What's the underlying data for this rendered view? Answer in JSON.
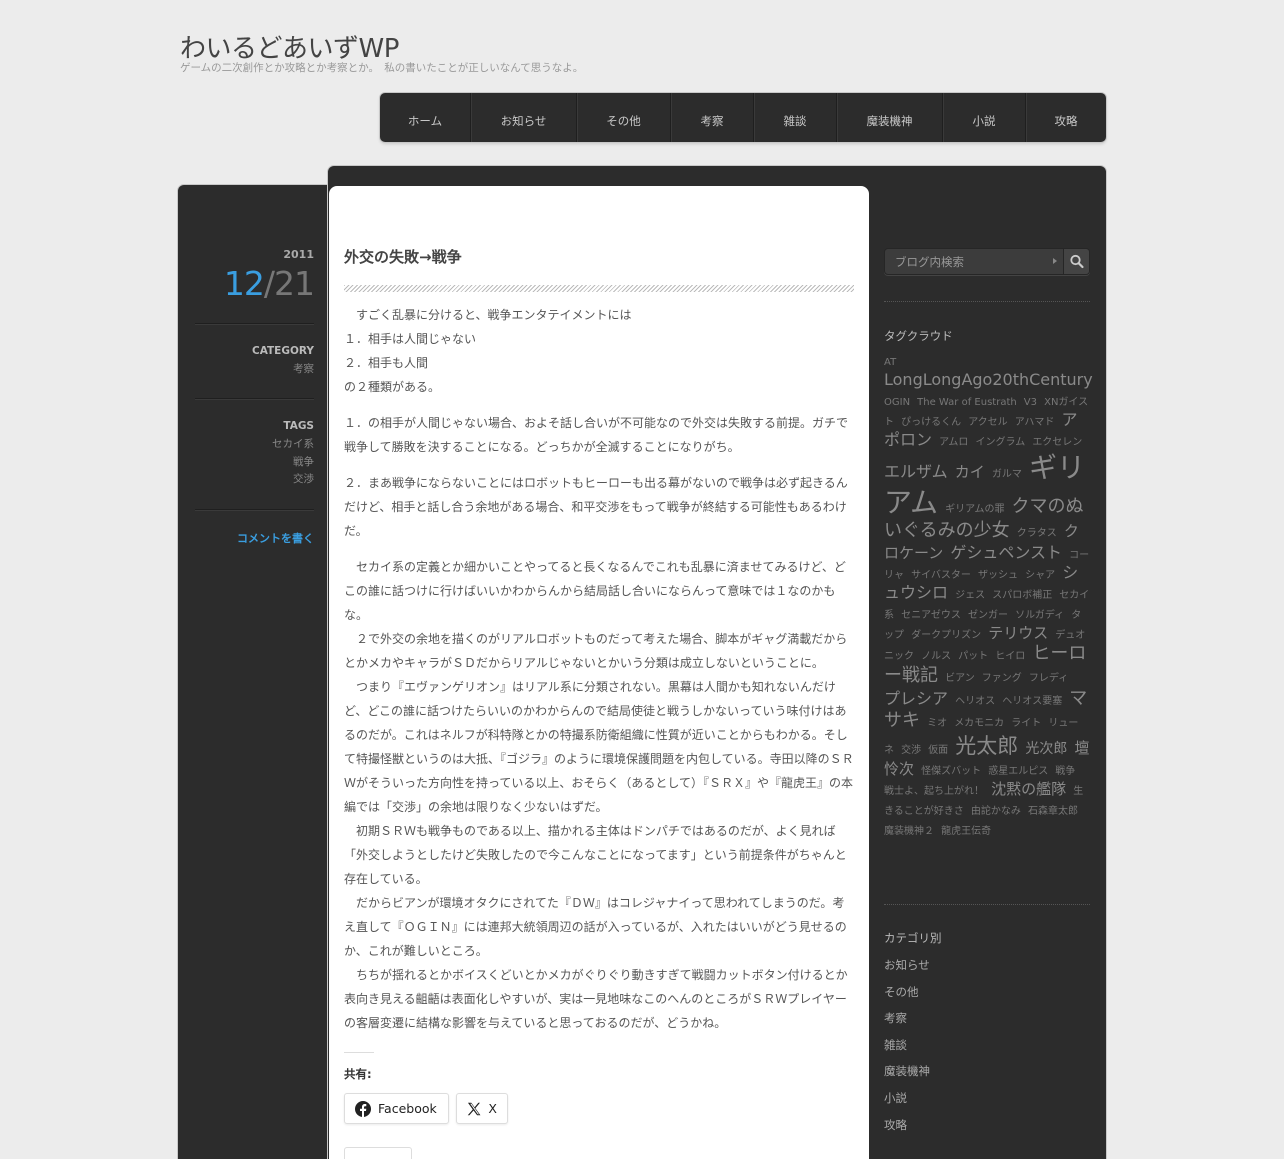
{
  "site": {
    "title": "わいるどあいずWP",
    "description": "ゲームの二次創作とか攻略とか考察とか。　私の書いたことが正しいなんて思うなよ。"
  },
  "nav": {
    "items": [
      "ホーム",
      "お知らせ",
      "その他",
      "考察",
      "雑談",
      "魔装機神",
      "小説",
      "攻略"
    ]
  },
  "post": {
    "year": "2011",
    "month": "12",
    "day": "/21",
    "category_label": "CATEGORY",
    "category": "考察",
    "tags_label": "TAGS",
    "tags": [
      "セカイ系",
      "戦争",
      "交渉"
    ],
    "comment_link": "コメントを書く",
    "title": "外交の失敗→戦争",
    "paragraphs": [
      "　すごく乱暴に分けると、戦争エンタテイメントには",
      "１．相手は人間じゃない",
      "２．相手も人間",
      "の２種類がある。",
      "１．の相手が人間じゃない場合、およそ話し合いが不可能なので外交は失敗する前提。ガチで戦争して勝敗を決することになる。どっちかが全滅することになりがち。",
      "２．まあ戦争にならないことにはロボットもヒーローも出る幕がないので戦争は必ず起きるんだけど、相手と話し合う余地がある場合、和平交渉をもって戦争が終結する可能性もあるわけだ。",
      "　セカイ系の定義とか細かいことやってると長くなるんでこれも乱暴に済ませてみるけど、どこの誰に話つけに行けばいいかわからんから結局話し合いにならんって意味では１なのかもな。",
      "　２で外交の余地を描くのがリアルロボットものだって考えた場合、脚本がギャグ満載だからとかメカやキャラがＳＤだからリアルじゃないとかいう分類は成立しないということに。",
      "　つまり『エヴァンゲリオン』はリアル系に分類されない。黒幕は人間かも知れないんだけど、どこの誰に話つけたらいいのかわからんので結局使徒と戦うしかないっていう味付けはあるのだが。これはネルフが科特隊とかの特撮系防衛組織に性質が近いことからもわかる。そして特撮怪獣というのは大抵、『ゴジラ』のように環境保護問題を内包している。寺田以降のＳＲＷがそういった方向性を持っている以上、おそらく（あるとして）『ＳＲＸ』や『龍虎王』の本編では「交渉」の余地は限りなく少ないはずだ。",
      "　初期ＳＲＷも戦争ものである以上、描かれる主体はドンパチではあるのだが、よく見れば「外交しようとしたけど失敗したので今こんなことになってます」という前提条件がちゃんと存在している。",
      "　だからビアンが環境オタクにされてた『ＤＷ』はコレジャナイって思われてしまうのだ。考え直して『ＯＧＩＮ』には連邦大統領周辺の話が入っているが、入れたはいいがどう見せるのか、これが難しいところ。",
      "　ちちが揺れるとかボイスくどいとかメカがぐりぐり動きすぎて戦闘カットボタン付けるとか表向き見える齟齬は表面化しやすいが、実は一見地味なこのへんのところがＳＲＷプレイヤーの客層変遷に結構な影響を与えていると思っておるのだが、どうかね。"
    ],
    "share_label": "共有:",
    "share_facebook": "Facebook",
    "share_x": "X"
  },
  "sidebar": {
    "search_placeholder": "ブログ内検索",
    "tagcloud_title": "タグクラウド",
    "tags": [
      {
        "t": "AT",
        "s": 10
      },
      {
        "t": "LongLongAgo20thCentury",
        "s": 16
      },
      {
        "t": "OGIN",
        "s": 10
      },
      {
        "t": "The War of Eustrath",
        "s": 10
      },
      {
        "t": "V3",
        "s": 10
      },
      {
        "t": "XNガイスト",
        "s": 10
      },
      {
        "t": "ぴっけるくん",
        "s": 10
      },
      {
        "t": "アクセル",
        "s": 10
      },
      {
        "t": "アハマド",
        "s": 10
      },
      {
        "t": "アポロン",
        "s": 16
      },
      {
        "t": "アムロ",
        "s": 10
      },
      {
        "t": "イングラム",
        "s": 10
      },
      {
        "t": "エクセレン",
        "s": 10
      },
      {
        "t": "エルザム",
        "s": 16
      },
      {
        "t": "カイ",
        "s": 15
      },
      {
        "t": "ガルマ",
        "s": 10
      },
      {
        "t": "ギリアム",
        "s": 28
      },
      {
        "t": "ギリアムの罪",
        "s": 10
      },
      {
        "t": "クマのぬいぐるみの少女",
        "s": 18
      },
      {
        "t": "クラタス",
        "s": 10
      },
      {
        "t": "クロケーン",
        "s": 15
      },
      {
        "t": "ゲシュペンスト",
        "s": 16
      },
      {
        "t": "コーリャ",
        "s": 10
      },
      {
        "t": "サイバスター",
        "s": 10
      },
      {
        "t": "ザッシュ",
        "s": 10
      },
      {
        "t": "シャア",
        "s": 10
      },
      {
        "t": "シュウシロ",
        "s": 16
      },
      {
        "t": "ジェス",
        "s": 10
      },
      {
        "t": "スパロボ補正",
        "s": 10
      },
      {
        "t": "セカイ系",
        "s": 10
      },
      {
        "t": "セニアゼウス",
        "s": 10
      },
      {
        "t": "ゼンガー",
        "s": 10
      },
      {
        "t": "ソルガディ",
        "s": 10
      },
      {
        "t": "タップ",
        "s": 10
      },
      {
        "t": "ダークプリズン",
        "s": 10
      },
      {
        "t": "テリウス",
        "s": 15
      },
      {
        "t": "デュオ",
        "s": 10
      },
      {
        "t": "ニック",
        "s": 10
      },
      {
        "t": "ノルス",
        "s": 10
      },
      {
        "t": "パット",
        "s": 10
      },
      {
        "t": "ヒイロ",
        "s": 10
      },
      {
        "t": "ヒーロー戦記",
        "s": 18
      },
      {
        "t": "ビアン",
        "s": 10
      },
      {
        "t": "ファング",
        "s": 10
      },
      {
        "t": "フレディ",
        "s": 10
      },
      {
        "t": "プレシア",
        "s": 16
      },
      {
        "t": "ヘリオス",
        "s": 10
      },
      {
        "t": "ヘリオス要塞",
        "s": 10
      },
      {
        "t": "マサキ",
        "s": 18
      },
      {
        "t": "ミオ",
        "s": 10
      },
      {
        "t": "メカモニカ",
        "s": 10
      },
      {
        "t": "ライト",
        "s": 10
      },
      {
        "t": "リューネ",
        "s": 10
      },
      {
        "t": "交渉",
        "s": 10
      },
      {
        "t": "仮面",
        "s": 10
      },
      {
        "t": "光太郎",
        "s": 21
      },
      {
        "t": "光次郎",
        "s": 14
      },
      {
        "t": "壇 怜次",
        "s": 15
      },
      {
        "t": "怪傑ズバット",
        "s": 10
      },
      {
        "t": "惑星エルピス",
        "s": 10
      },
      {
        "t": "戦争",
        "s": 10
      },
      {
        "t": "戦士よ、起ち上がれ！",
        "s": 10
      },
      {
        "t": "沈黙の艦隊",
        "s": 15
      },
      {
        "t": "生きることが好きさ",
        "s": 10
      },
      {
        "t": "由詑かなみ",
        "s": 10
      },
      {
        "t": "石森章太郎",
        "s": 10
      },
      {
        "t": "魔装機神２",
        "s": 10
      },
      {
        "t": "龍虎王伝奇",
        "s": 10
      }
    ],
    "categories_title": "カテゴリ別",
    "categories": [
      "お知らせ",
      "その他",
      "考察",
      "雑談",
      "魔装機神",
      "小説",
      "攻略"
    ]
  }
}
